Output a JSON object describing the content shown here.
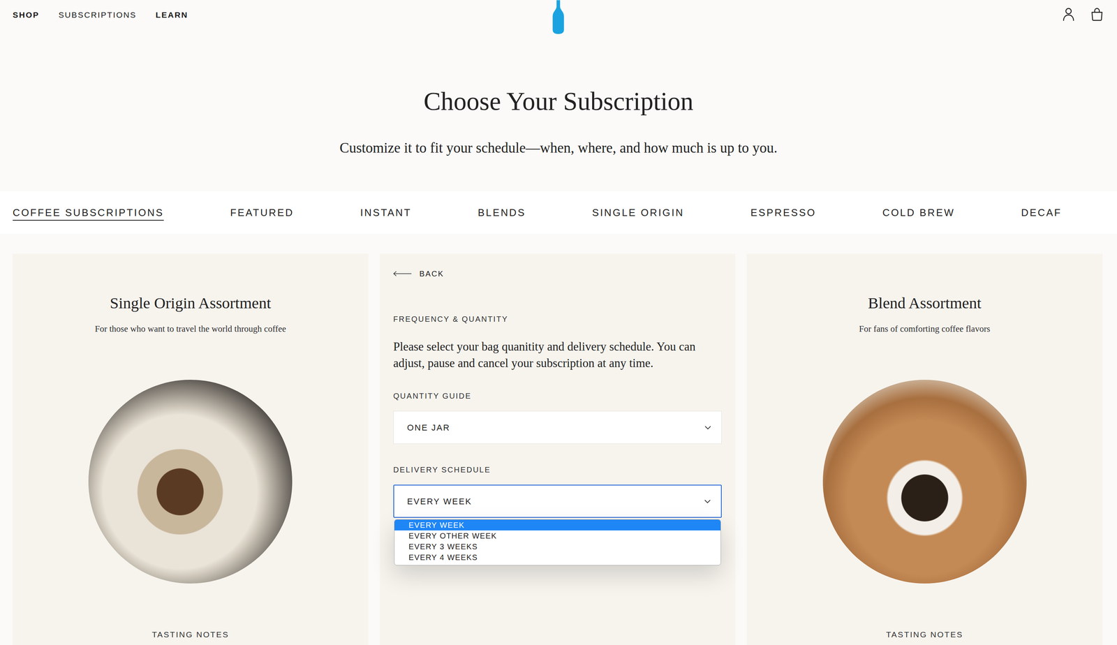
{
  "nav": {
    "links": [
      {
        "label": "SHOP",
        "selected": false
      },
      {
        "label": "SUBSCRIPTIONS",
        "selected": true
      },
      {
        "label": "LEARN",
        "selected": false
      }
    ]
  },
  "hero": {
    "title": "Choose Your Subscription",
    "subtitle": "Customize it to fit your schedule—when, where, and how much is up to you."
  },
  "categories": [
    {
      "label": "COFFEE SUBSCRIPTIONS",
      "selected": true
    },
    {
      "label": "FEATURED",
      "selected": false
    },
    {
      "label": "INSTANT",
      "selected": false
    },
    {
      "label": "BLENDS",
      "selected": false
    },
    {
      "label": "SINGLE ORIGIN",
      "selected": false
    },
    {
      "label": "ESPRESSO",
      "selected": false
    },
    {
      "label": "COLD BREW",
      "selected": false
    },
    {
      "label": "DECAF",
      "selected": false
    }
  ],
  "products": [
    {
      "title": "Single Origin Assortment",
      "subtitle": "For those who want to travel the world through coffee",
      "tasting_label": "TASTING NOTES"
    },
    {
      "title": "Blend Assortment",
      "subtitle": "For fans of comforting coffee flavors",
      "tasting_label": "TASTING NOTES"
    }
  ],
  "configurator": {
    "back": "BACK",
    "heading": "FREQUENCY & QUANTITY",
    "description": "Please select your bag quanitity and delivery schedule. You can adjust, pause and cancel your subscription at any time.",
    "quantity": {
      "label": "QUANTITY GUIDE",
      "value": "ONE JAR",
      "expanded": false
    },
    "schedule": {
      "label": "DELIVERY SCHEDULE",
      "value": "EVERY WEEK",
      "expanded": true,
      "options": [
        {
          "label": "EVERY WEEK",
          "selected": true
        },
        {
          "label": "EVERY OTHER WEEK",
          "selected": false
        },
        {
          "label": "EVERY 3 WEEKS",
          "selected": false
        },
        {
          "label": "EVERY 4 WEEKS",
          "selected": false
        }
      ]
    }
  }
}
